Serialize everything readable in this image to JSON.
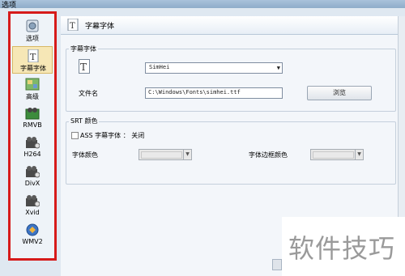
{
  "window": {
    "title": "选项"
  },
  "sidebar": {
    "items": [
      {
        "label": "选项",
        "icon": "options-icon"
      },
      {
        "label": "字幕字体",
        "icon": "subtitle-font-icon",
        "selected": true
      },
      {
        "label": "高级",
        "icon": "advanced-icon"
      },
      {
        "label": "RMVB",
        "icon": "rmvb-film-icon"
      },
      {
        "label": "H264",
        "icon": "h264-film-icon"
      },
      {
        "label": "DivX",
        "icon": "divx-film-icon"
      },
      {
        "label": "Xvid",
        "icon": "xvid-film-icon"
      },
      {
        "label": "WMV2",
        "icon": "wmv2-icon"
      }
    ]
  },
  "header": {
    "title": "字幕字体"
  },
  "font_group": {
    "label": "字幕字体",
    "font_value": "SimHei",
    "file_label": "文件名",
    "file_value": "C:\\Windows\\Fonts\\simhei.ttf",
    "browse_label": "浏览"
  },
  "srt_group": {
    "label": "SRT 颜色",
    "ass_label": "ASS 字幕字体 ： 关闭",
    "font_color_label": "字体颜色",
    "border_color_label": "字体边框颜色"
  },
  "watermark": {
    "text": "软件技巧"
  },
  "colors": {
    "highlight_border": "#d61a1a",
    "selected_bg": "#f6e7b6"
  }
}
